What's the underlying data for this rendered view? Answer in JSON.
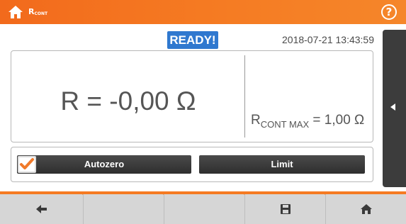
{
  "header": {
    "title_main": "R",
    "title_sub": "CONT",
    "home_icon": "home-icon",
    "help_icon": "help-icon",
    "help_glyph": "?"
  },
  "status": {
    "badge": "READY!",
    "datetime": "2018-07-21 13:43:59"
  },
  "measurement": {
    "result": "R = -0,00 Ω",
    "limit_prefix": "R",
    "limit_sub": "CONT MAX",
    "limit_value": " = 1,00 Ω"
  },
  "buttons": {
    "autozero": "Autozero",
    "limit": "Limit",
    "autozero_checked": true
  },
  "nav": {
    "items": [
      "back-icon",
      "empty",
      "empty",
      "save-icon",
      "home-icon"
    ]
  },
  "colors": {
    "accent": "#f57a22",
    "ready": "#2f78cf",
    "check": "#f07a2a"
  }
}
